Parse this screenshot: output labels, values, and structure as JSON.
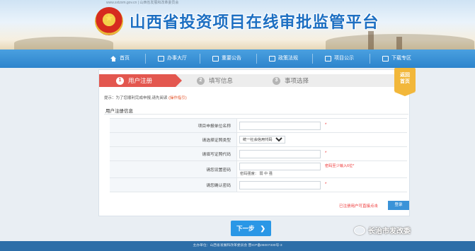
{
  "header": {
    "topline": "www.sxtzxm.gov.cn | 山西省发展和改革委员会",
    "title": "山西省投资项目在线审批监管平台"
  },
  "nav": [
    {
      "label": "首页",
      "icon": "home-icon"
    },
    {
      "label": "办事大厅",
      "icon": "hall-icon"
    },
    {
      "label": "重要公告",
      "icon": "notice-icon"
    },
    {
      "label": "政策法规",
      "icon": "policy-icon"
    },
    {
      "label": "项目公示",
      "icon": "project-icon"
    },
    {
      "label": "下载专区",
      "icon": "download-icon"
    }
  ],
  "steps": [
    {
      "num": "1",
      "label": "用户注册"
    },
    {
      "num": "2",
      "label": "填写信息"
    },
    {
      "num": "3",
      "label": "事项选择"
    }
  ],
  "back_badge": {
    "line1": "返回",
    "line2": "首页"
  },
  "hint": {
    "text": "提示：为了您顺利完成申报,请先阅读",
    "guide": "(操作指引)"
  },
  "section_title": "用户注册信息",
  "form": {
    "unit_name_label": "项目申报单位名称",
    "cert_type_label": "请选择证照类型",
    "cert_type_value": "统一社会信用代码",
    "cert_code_label": "请填写证照代码",
    "password_label": "请您设置密码",
    "password_hint": "密码至少输入6位*",
    "strength_text": "密码强度：  弱  中  强",
    "confirm_label": "请您确认密码",
    "required_mark": "*"
  },
  "login_hint": "已注册用户可直接点击",
  "login_button": "登录",
  "next_button": "下一步",
  "footer": "主办单位：山西省发展和改革委员会    晋ICP备06007330号-3",
  "watermark": "长治市发改委",
  "colors": {
    "nav": "#2d84cc",
    "active_step": "#e3574f",
    "accent": "#2a97e6",
    "badge": "#f2b73a"
  }
}
